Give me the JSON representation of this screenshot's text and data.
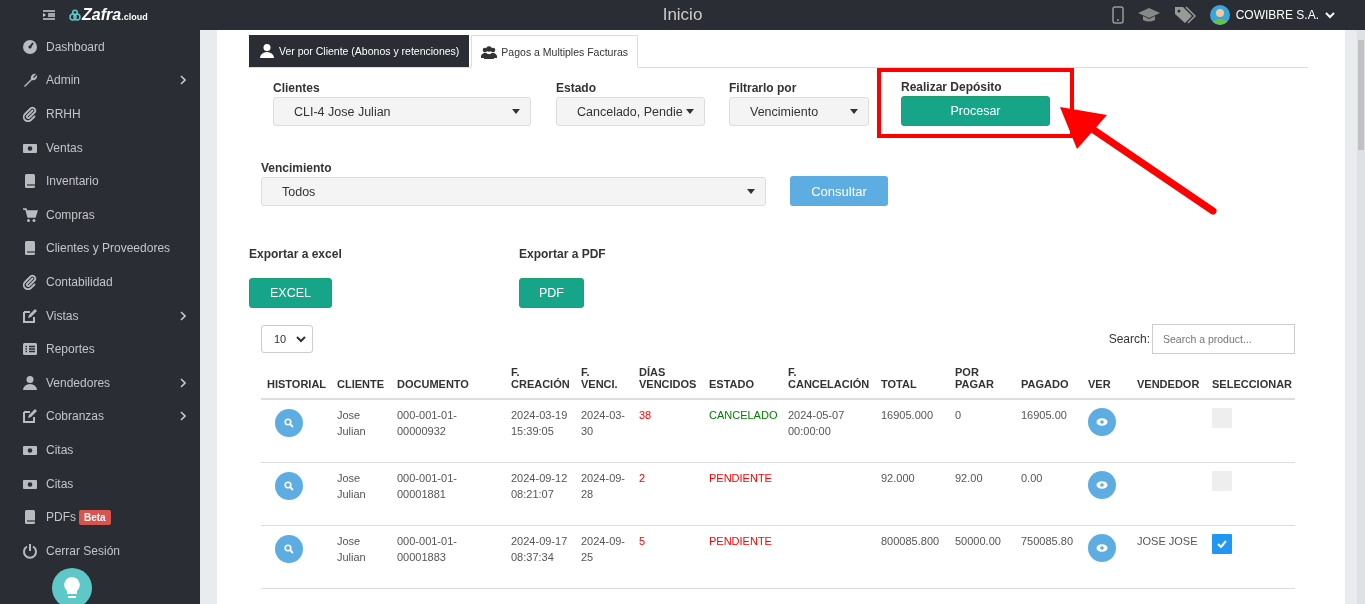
{
  "topbar": {
    "logo": {
      "main": "Zafra",
      "suffix": ".cloud"
    },
    "title": "Inicio",
    "user": "COWIBRE S.A."
  },
  "sidebar": {
    "items": [
      {
        "label": "Dashboard",
        "expandable": false
      },
      {
        "label": "Admin",
        "expandable": true
      },
      {
        "label": "RRHH",
        "expandable": false
      },
      {
        "label": "Ventas",
        "expandable": false
      },
      {
        "label": "Inventario",
        "expandable": false
      },
      {
        "label": "Compras",
        "expandable": false
      },
      {
        "label": "Clientes y Proveedores",
        "expandable": false
      },
      {
        "label": "Contabilidad",
        "expandable": false
      },
      {
        "label": "Vistas",
        "expandable": true
      },
      {
        "label": "Reportes",
        "expandable": false
      },
      {
        "label": "Vendedores",
        "expandable": true
      },
      {
        "label": "Cobranzas",
        "expandable": true
      },
      {
        "label": "Citas",
        "expandable": false
      },
      {
        "label": "Citas",
        "expandable": false
      },
      {
        "label": "PDFs",
        "expandable": false,
        "badge": "Beta"
      },
      {
        "label": "Cerrar Sesión",
        "expandable": false
      }
    ]
  },
  "tabs": [
    {
      "label": "Ver por Cliente (Abonos y retenciones)",
      "selected": false
    },
    {
      "label": "Pagos a Multiples Facturas",
      "selected": true
    }
  ],
  "filters": [
    {
      "kind": "select",
      "label": "Clientes",
      "value": "CLI-4 Jose Julian",
      "highlighted": false
    },
    {
      "kind": "select",
      "label": "Estado",
      "value": "Cancelado, Pendie",
      "highlighted": false
    },
    {
      "kind": "select",
      "label": "Filtrarlo por",
      "value": "Vencimiento",
      "highlighted": false
    },
    {
      "kind": "button",
      "label": "Realizar Depósito",
      "value": "Procesar",
      "highlighted": true
    }
  ],
  "due_filter": {
    "label": "Vencimiento",
    "value": "Todos",
    "button": "Consultar"
  },
  "exports": [
    {
      "label": "Exportar a excel",
      "button": "EXCEL"
    },
    {
      "label": "Exportar a PDF",
      "button": "PDF"
    }
  ],
  "page_size": "10",
  "search": {
    "label": "Search:",
    "placeholder": "Search a product..."
  },
  "table": {
    "columns": [
      "HISTORIAL",
      "CLIENTE",
      "DOCUMENTO",
      "F. CREACIÓN",
      "F. VENCI.",
      "DÍAS VENCIDOS",
      "ESTADO",
      "F. CANCELACIÓN",
      "TOTAL",
      "POR PAGAR",
      "PAGADO",
      "VER",
      "VENDEDOR",
      "SELECCIONAR"
    ],
    "rows": [
      {
        "cliente": "Jose Julian",
        "documento": "000-001-01-00000932",
        "creacion": "2024-03-19 15:39:05",
        "venci": "2024-03-30",
        "dias": "38",
        "estado": "CANCELADO",
        "color": "#008000",
        "cancelacion": "2024-05-07 00:00:00",
        "total": "16905.000",
        "por_pagar": "0",
        "pagado": "16905.00",
        "selected": false
      },
      {
        "cliente": "Jose Julian",
        "documento": "000-001-01-00001881",
        "creacion": "2024-09-12 08:21:07",
        "venci": "2024-09-28",
        "dias": "2",
        "estado": "PENDIENTE",
        "color": "#ff0000",
        "total": "92.000",
        "por_pagar": "92.00",
        "pagado": "0.00",
        "selected": false
      },
      {
        "cliente": "Jose Julian",
        "documento": "000-001-01-00001883",
        "creacion": "2024-09-17 08:37:34",
        "venci": "2024-09-25",
        "dias": "5",
        "estado": "PENDIENTE",
        "color": "#ff0000",
        "total": "800085.800",
        "por_pagar": "50000.00",
        "pagado": "750085.80",
        "vendedor": "JOSE JOSE",
        "selected": true
      }
    ]
  }
}
